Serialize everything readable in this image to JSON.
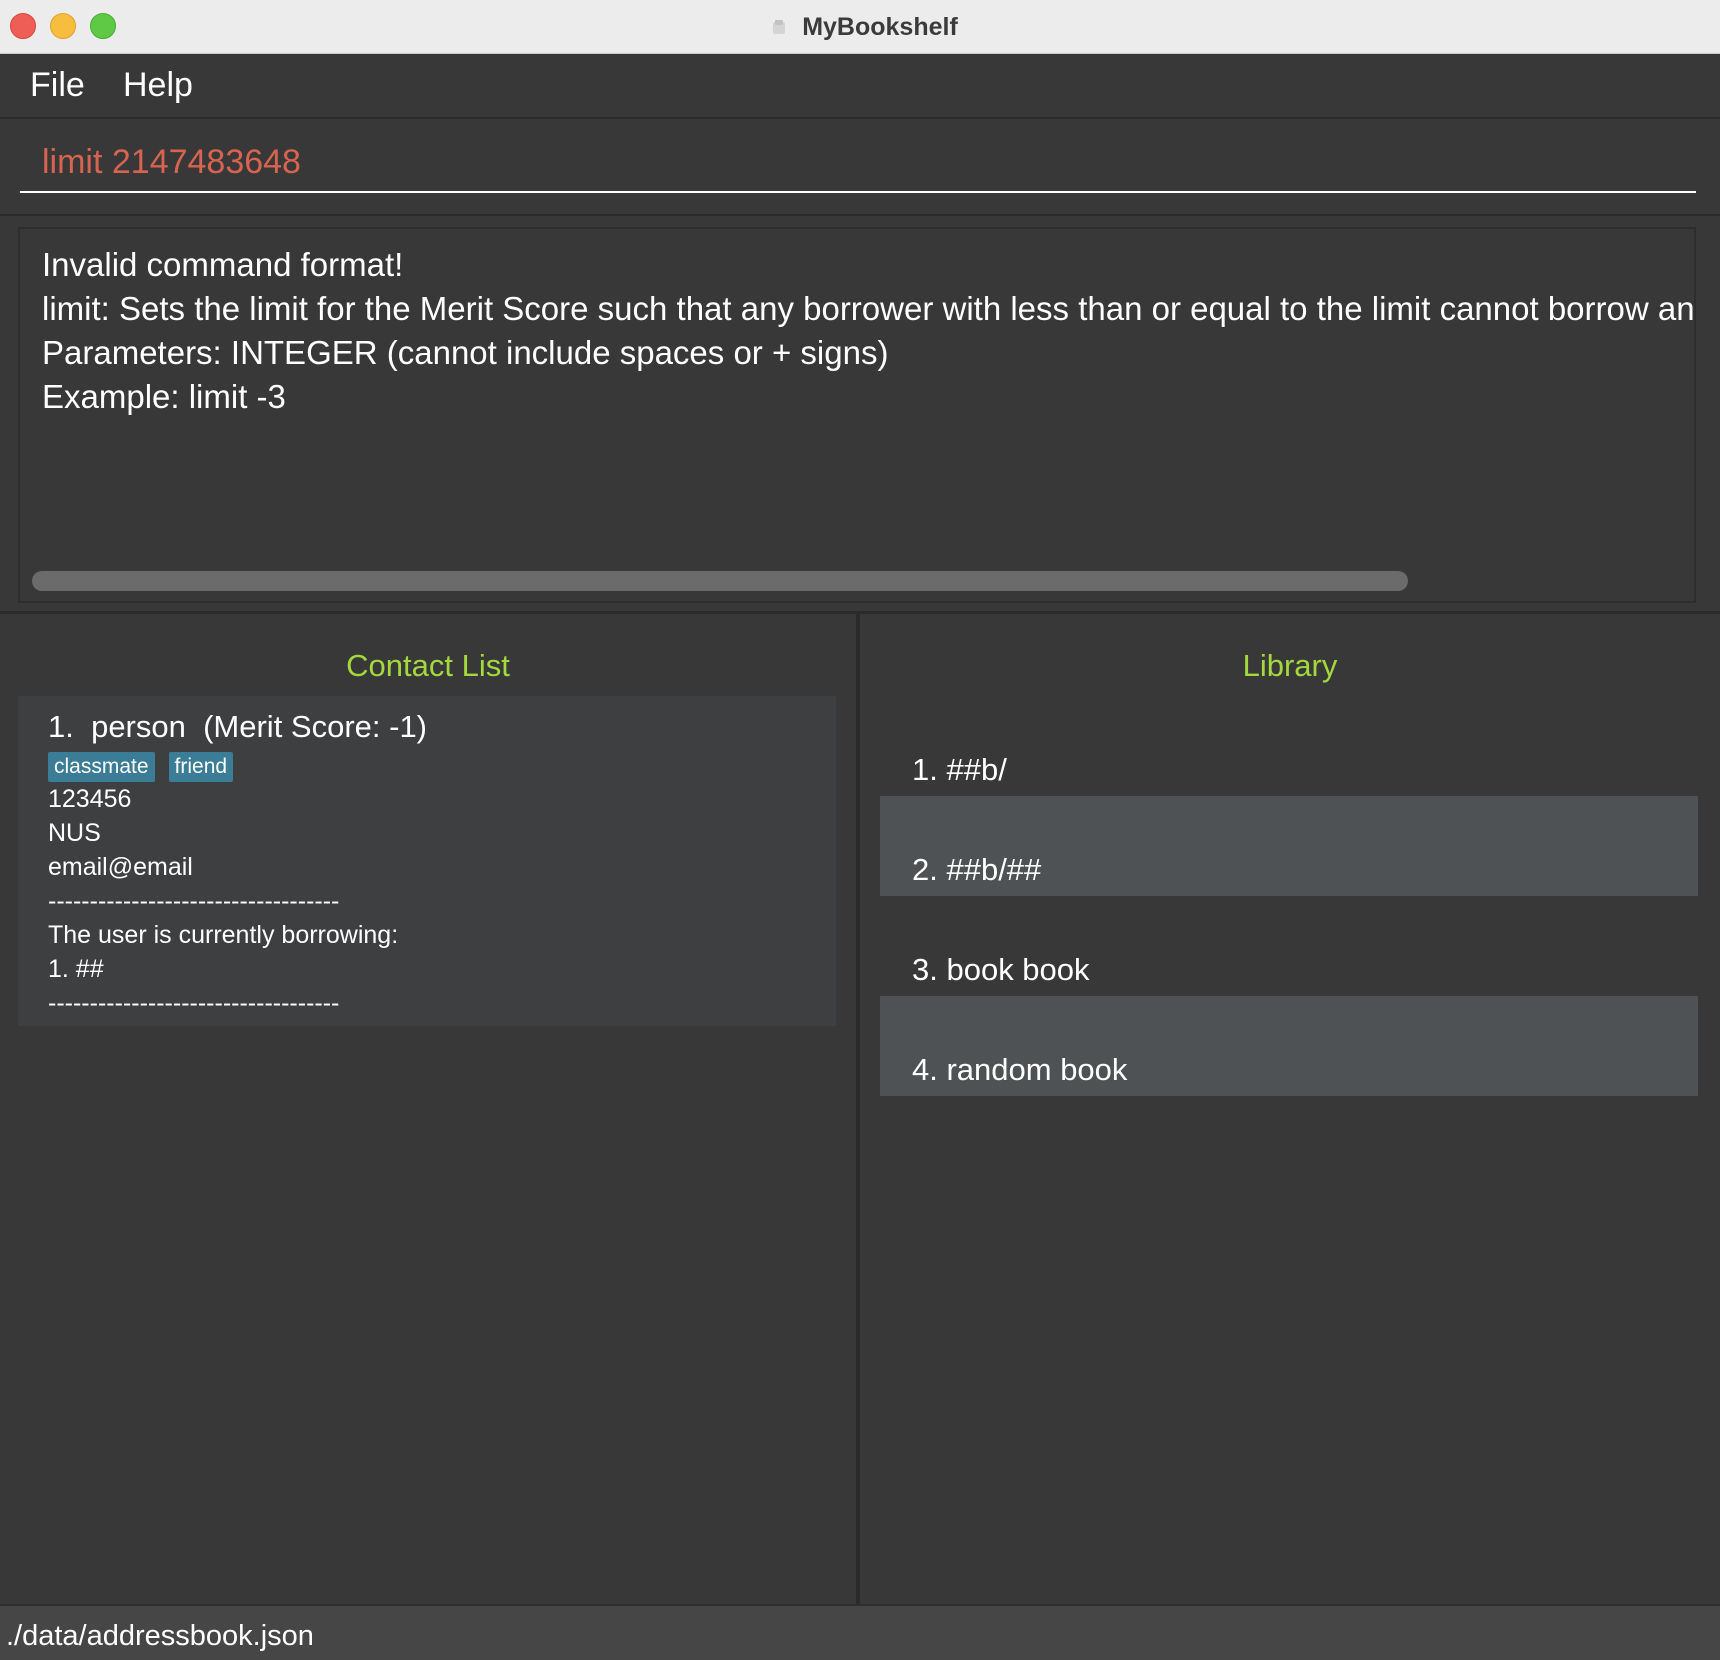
{
  "window": {
    "title": "MyBookshelf",
    "title_icon": "document-proxy-icon"
  },
  "menu": {
    "items": [
      {
        "label": "File"
      },
      {
        "label": "Help"
      }
    ]
  },
  "command": {
    "value": "limit 2147483648",
    "error_color": "#d76451"
  },
  "result": {
    "lines": [
      "Invalid command format!",
      "limit: Sets the limit for the Merit Score such that any borrower with less than or equal to the limit cannot borrow any b",
      "Parameters: INTEGER (cannot include spaces or + signs)",
      "Example: limit -3"
    ]
  },
  "contact_panel": {
    "title": "Contact List",
    "title_color": "#a3d93d",
    "contacts": [
      {
        "name_line": "1.  person  (Merit Score: -1)",
        "tags": [
          "classmate",
          "friend"
        ],
        "phone": "123456",
        "address": "NUS",
        "email": "email@email",
        "separator": "-----------------------------------",
        "borrowing_header": "The user is currently borrowing:",
        "borrowed": [
          "1. ##"
        ],
        "separator_end": "-----------------------------------"
      }
    ]
  },
  "library_panel": {
    "title": "Library",
    "books": [
      {
        "label": "1. ##b/"
      },
      {
        "label": "2. ##b/##"
      },
      {
        "label": "3. book book"
      },
      {
        "label": "4. random book"
      }
    ]
  },
  "status": {
    "file_path": "./data/addressbook.json"
  }
}
